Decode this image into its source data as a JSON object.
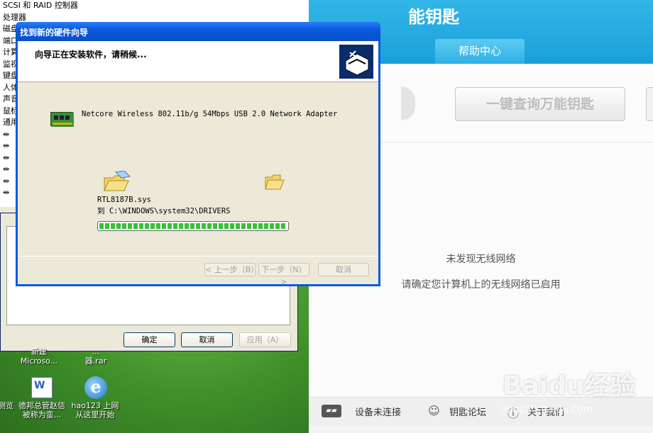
{
  "device_tree": [
    "SCSI 和 RAID 控制器",
    "处理器",
    "磁盘",
    "端口",
    "计算",
    "监视",
    "键盘",
    "人体",
    "声音",
    "鼠标",
    "通用"
  ],
  "properties_dialog": {
    "ok_label": "确定",
    "cancel_label": "取消",
    "apply_label": "应用（A）"
  },
  "desktop_icons": [
    {
      "label_line1": "新建",
      "label_line2": "Microso..."
    },
    {
      "label_line1": "...",
      "label_line2": "器.rar"
    },
    {
      "label_line1": "德邦总管赵信",
      "label_line2": "被称为蛮..."
    },
    {
      "label_line1": "hao123 上网",
      "label_line2": "从这里开始"
    },
    {
      "label_line1": "测览",
      "label_line2": ""
    }
  ],
  "wizard": {
    "title": "找到新的硬件向导",
    "header_text": "向导正在安装软件，请稍候...",
    "device_name": "Netcore Wireless 802.11b/g 54Mbps USB 2.0 Network Adapter",
    "file_name": "RTL8187B.sys",
    "destination": "到 C:\\WINDOWS\\system32\\DRIVERS",
    "progress": 1.0,
    "back_label": "< 上一步（B）",
    "next_label": "下一步（N）>",
    "cancel_label": "取消"
  },
  "app": {
    "title": "能钥匙",
    "help_tab": "帮助中心",
    "query_button": "一键查询万能钥匙",
    "message_no_network": "未发现无线网络",
    "message_enable_wifi": "请确定您计算机上的无线网络已启用",
    "footer": {
      "device_status": "设备未连接",
      "forum": "钥匙论坛",
      "about": "关于我们"
    },
    "accent_color": "#1aa0d8"
  },
  "watermark": {
    "brand": "Baidu经验",
    "url": "jingyan.baidu.com"
  }
}
